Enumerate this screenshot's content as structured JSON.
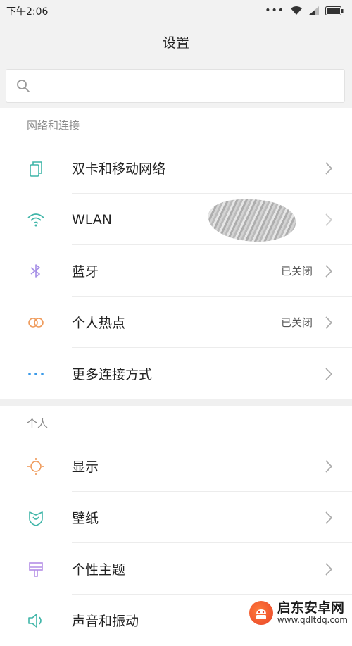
{
  "status_bar": {
    "time": "下午2:06",
    "dots": "•••"
  },
  "header": {
    "title": "设置"
  },
  "search": {
    "placeholder": ""
  },
  "sections": {
    "network": {
      "title": "网络和连接",
      "items": [
        {
          "label": "双卡和移动网络",
          "value": "",
          "icon": "dual-sim-icon",
          "color": "#3fb5a8"
        },
        {
          "label": "WLAN",
          "value": "",
          "icon": "wifi-icon",
          "color": "#3fb5a8"
        },
        {
          "label": "蓝牙",
          "value": "已关闭",
          "icon": "bluetooth-icon",
          "color": "#a58ee6"
        },
        {
          "label": "个人热点",
          "value": "已关闭",
          "icon": "hotspot-icon",
          "color": "#ef9a5a"
        },
        {
          "label": "更多连接方式",
          "value": "",
          "icon": "more-dots-icon",
          "color": "#3b9ae8"
        }
      ]
    },
    "personal": {
      "title": "个人",
      "items": [
        {
          "label": "显示",
          "value": "",
          "icon": "brightness-icon",
          "color": "#ef9a5a"
        },
        {
          "label": "壁纸",
          "value": "",
          "icon": "wallpaper-icon",
          "color": "#3fb5a8"
        },
        {
          "label": "个性主题",
          "value": "",
          "icon": "theme-icon",
          "color": "#b48ee6"
        },
        {
          "label": "声音和振动",
          "value": "",
          "icon": "speaker-icon",
          "color": "#3fb5a8"
        }
      ]
    }
  },
  "watermark": {
    "title": "启东安卓网",
    "url": "www.qdltdq.com"
  }
}
